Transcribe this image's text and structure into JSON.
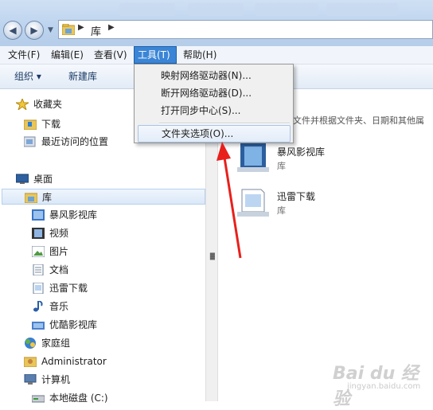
{
  "address": {
    "crumb": "库"
  },
  "menubar": [
    "文件(F)",
    "编辑(E)",
    "查看(V)",
    "工具(T)",
    "帮助(H)"
  ],
  "toolbar": {
    "organize": "组织 ▾",
    "new_library": "新建库"
  },
  "tools_menu": {
    "items": [
      "映射网络驱动器(N)...",
      "断开网络驱动器(D)...",
      "打开同步中心(S)...",
      "文件夹选项(O)..."
    ]
  },
  "nav": {
    "favorites": "收藏夹",
    "downloads": "下载",
    "recent": "最近访问的位置",
    "desktop": "桌面",
    "libraries": "库",
    "lib_items": [
      "暴风影视库",
      "视频",
      "图片",
      "文档",
      "迅雷下载",
      "音乐",
      "优酷影视库"
    ],
    "homegroup": "家庭组",
    "user": "Administrator",
    "computer": "计算机",
    "local_disk": "本地磁盘 (C:)"
  },
  "content": {
    "hint": "文件并根据文件夹、日期和其他属",
    "libraries": [
      {
        "name": "暴风影视库",
        "kind": "库"
      },
      {
        "name": "迅雷下载",
        "kind": "库"
      }
    ]
  },
  "watermark": {
    "main": "Bai du 经验",
    "sub": "jingyan.baidu.com"
  },
  "colors": {
    "menu_active": "#3b85d6",
    "arrow": "#e8201c"
  }
}
